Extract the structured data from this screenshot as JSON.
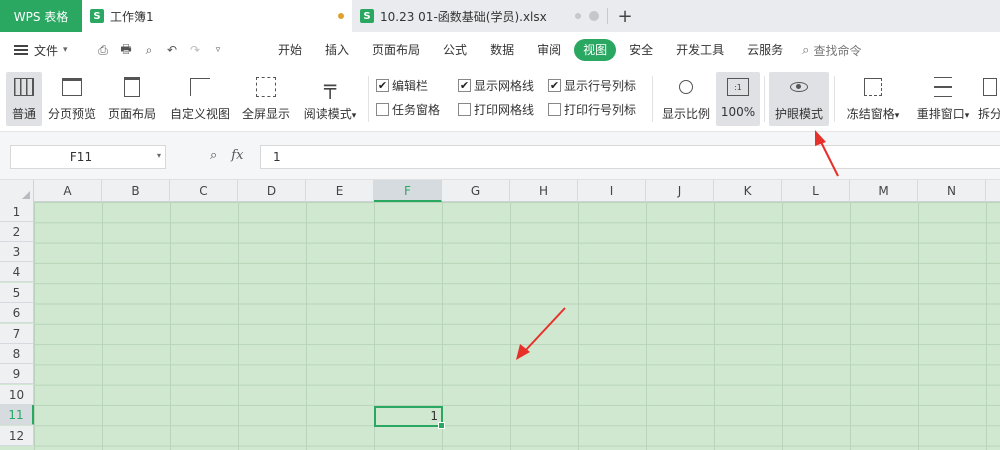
{
  "titlebar": {
    "brand": "WPS 表格",
    "tabs": [
      {
        "name": "工作簿1",
        "icon": "S",
        "active": true
      },
      {
        "name": "10.23   01-函数基础(学员).xlsx",
        "icon": "S",
        "active": false
      }
    ],
    "add_tab": "+"
  },
  "menubar": {
    "file_label": "文件",
    "quick_access_icons": [
      "save-icon",
      "print-icon",
      "print-preview-icon",
      "undo-icon",
      "redo-icon",
      "customize-icon"
    ],
    "tabs": [
      "开始",
      "插入",
      "页面布局",
      "公式",
      "数据",
      "审阅",
      "视图",
      "安全",
      "开发工具",
      "云服务"
    ],
    "active_tab": "视图",
    "search_placeholder": "查找命令"
  },
  "ribbon": {
    "normal": "普通",
    "page_break_preview": "分页预览",
    "page_layout": "页面布局",
    "custom_view": "自定义视图",
    "full_screen": "全屏显示",
    "reading_mode": "阅读模式",
    "checks": {
      "edit_bar": {
        "label": "编辑栏",
        "checked": true
      },
      "task_pane": {
        "label": "任务窗格",
        "checked": false
      },
      "show_gridlines": {
        "label": "显示网格线",
        "checked": true
      },
      "print_gridlines": {
        "label": "打印网格线",
        "checked": false
      },
      "show_headers": {
        "label": "显示行号列标",
        "checked": true
      },
      "print_headers": {
        "label": "打印行号列标",
        "checked": false
      }
    },
    "zoom_ratio": "显示比例",
    "zoom_100": "100%",
    "zoom_100_icon_text": ":1",
    "eye_mode": "护眼模式",
    "freeze_panes": "冻结窗格",
    "arrange_windows": "重排窗口",
    "split": "拆分"
  },
  "formula_bar": {
    "name_box": "F11",
    "fx": "fx",
    "value": "1"
  },
  "sheet": {
    "columns": [
      "A",
      "B",
      "C",
      "D",
      "E",
      "F",
      "G",
      "H",
      "I",
      "J",
      "K",
      "L",
      "M",
      "N"
    ],
    "rows": [
      "1",
      "2",
      "3",
      "4",
      "5",
      "6",
      "7",
      "8",
      "9",
      "10",
      "11",
      "12"
    ],
    "selected_column": "F",
    "selected_row": "11",
    "selected_cell_value": "1"
  },
  "colors": {
    "accent": "#2aa862",
    "grid_bg": "#cfe8cf",
    "arrow": "#e8302a"
  }
}
